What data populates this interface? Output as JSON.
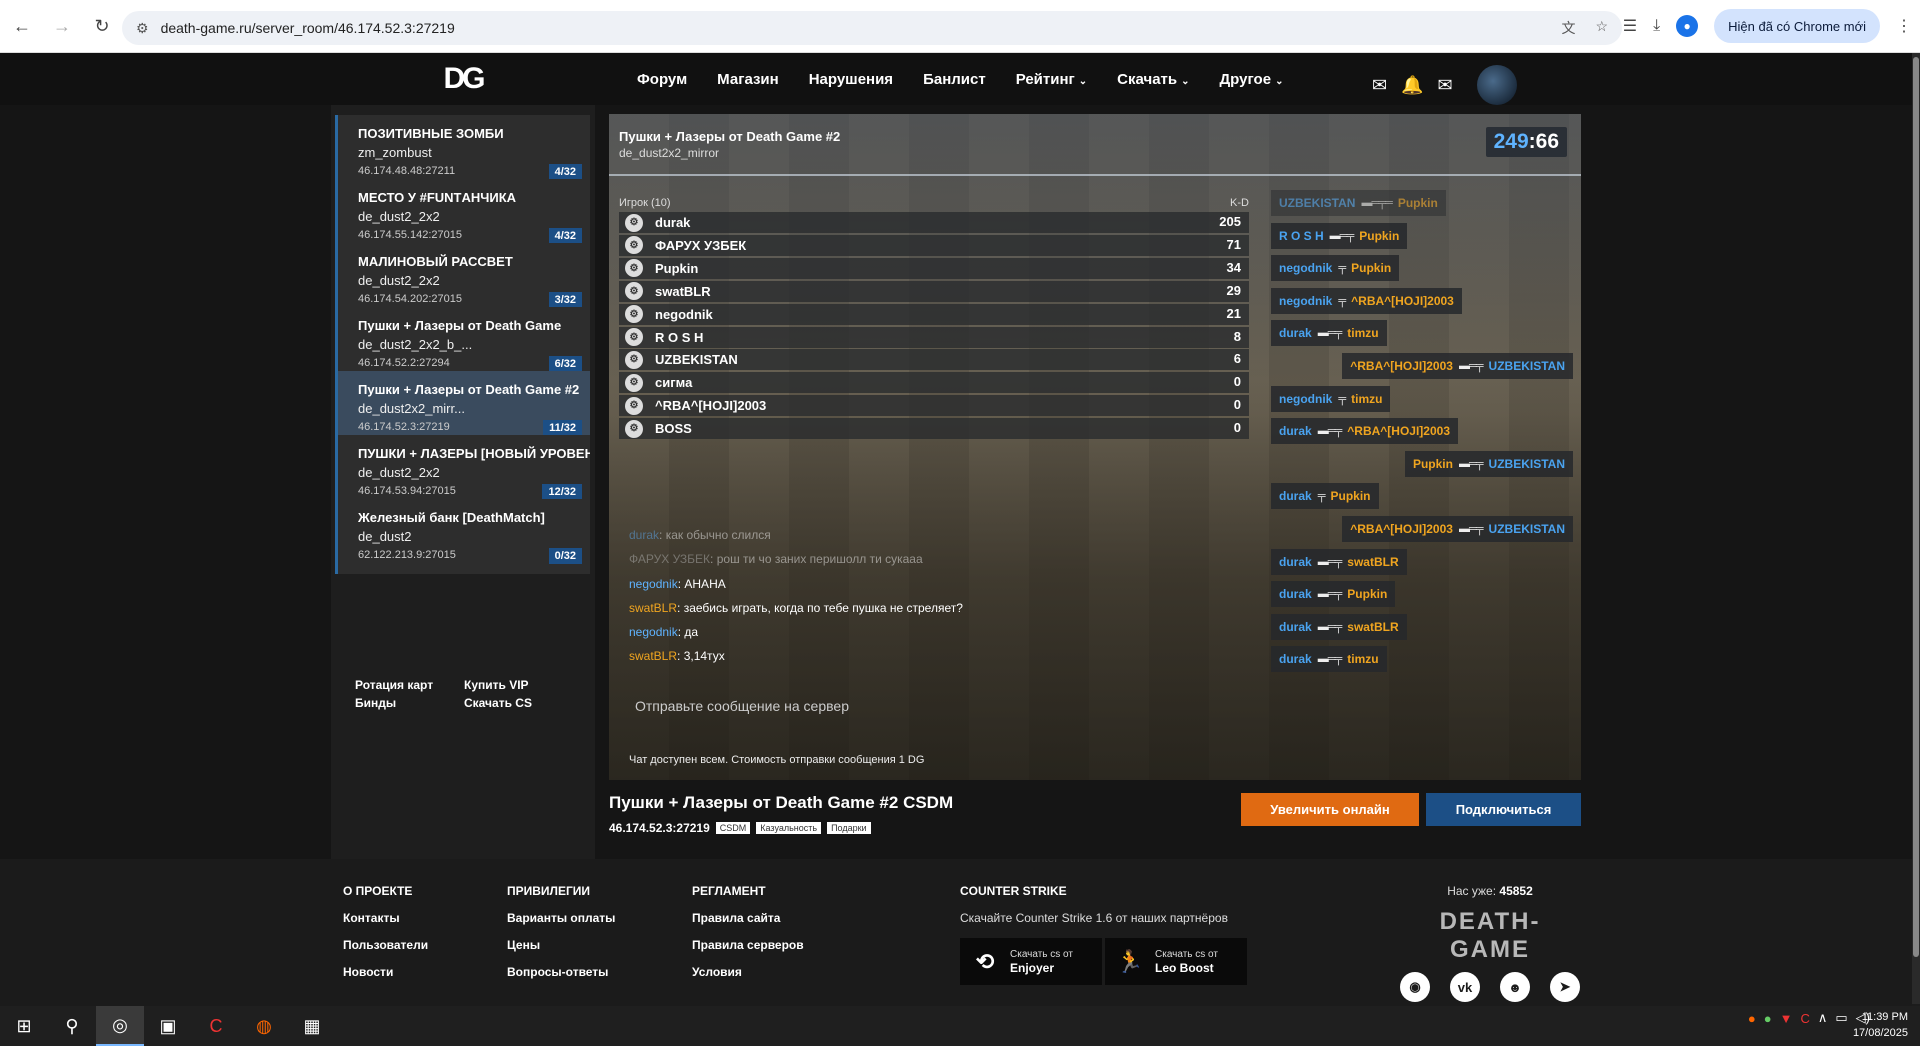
{
  "browser": {
    "url": "death-game.ru/server_room/46.174.52.3:27219",
    "update_label": "Hiện đã có Chrome mới"
  },
  "header": {
    "logo": "DG",
    "menu": [
      {
        "label": "Форум",
        "caret": false
      },
      {
        "label": "Магазин",
        "caret": false
      },
      {
        "label": "Нарушения",
        "caret": false
      },
      {
        "label": "Банлист",
        "caret": false
      },
      {
        "label": "Рейтинг",
        "caret": true
      },
      {
        "label": "Скачать",
        "caret": true
      },
      {
        "label": "Другое",
        "caret": true
      }
    ]
  },
  "sidebar": {
    "servers": [
      {
        "title": "ПОЗИТИВНЫЕ ЗОМБИ",
        "map": "zm_zombust",
        "ip": "46.174.48.48:27211",
        "count": "4/32"
      },
      {
        "title": "МЕСТО У #FUNTАНЧИКА",
        "map": "de_dust2_2x2",
        "ip": "46.174.55.142:27015",
        "count": "4/32"
      },
      {
        "title": "МАЛИНОВЫЙ РАССВЕТ",
        "map": "de_dust2_2x2",
        "ip": "46.174.54.202:27015",
        "count": "3/32"
      },
      {
        "title": "Пушки + Лазеры от Death Game",
        "map": "de_dust2_2x2_b_...",
        "ip": "46.174.52.2:27294",
        "count": "6/32"
      },
      {
        "title": "Пушки + Лазеры от Death Game #2",
        "map": "de_dust2x2_mirr...",
        "ip": "46.174.52.3:27219",
        "count": "11/32"
      },
      {
        "title": "ПУШКИ + ЛАЗЕРЫ [НОВЫЙ УРОВЕНЬ]",
        "map": "de_dust2_2x2",
        "ip": "46.174.53.94:27015",
        "count": "12/32"
      },
      {
        "title": "Железный банк [DeathMatch]",
        "map": "de_dust2",
        "ip": "62.122.213.9:27015",
        "count": "0/32"
      }
    ],
    "links": [
      "Ротация карт",
      "Купить VIP",
      "Бинды",
      "Скачать CS"
    ]
  },
  "game": {
    "title": "Пушки + Лазеры от Death Game #2",
    "map": "de_dust2x2_mirror",
    "timer_a": "249",
    "timer_b": "66",
    "players_header": "Игрок (10)",
    "kd_header": "K-D",
    "players": [
      {
        "name": "durak",
        "score": "205"
      },
      {
        "name": "ФАРУХ УЗБЕК",
        "score": "71"
      },
      {
        "name": "Pupkin",
        "score": "34"
      },
      {
        "name": "swatBLR",
        "score": "29"
      },
      {
        "name": "negodnik",
        "score": "21"
      },
      {
        "name": "R O S H",
        "score": "8"
      },
      {
        "name": "UZBEKISTAN",
        "score": "6"
      },
      {
        "name": "сигма",
        "score": "0"
      },
      {
        "name": "^RBA^[HOJI]2003",
        "score": "0"
      },
      {
        "name": "BOSS",
        "score": "0"
      }
    ],
    "chat": [
      {
        "name": "durak",
        "text": "как обычно слился",
        "color": "b",
        "faded": true
      },
      {
        "name": "ФАРУХ УЗБЕК",
        "text": "рош ти чо заних перишолл ти сукааа",
        "color": "g",
        "faded": true
      },
      {
        "name": "negodnik",
        "text": "АНАНА",
        "color": "b",
        "faded": false
      },
      {
        "name": "swatBLR",
        "text": "заебись играть, когда по тебе пушка не стреляет?",
        "color": "o",
        "faded": false
      },
      {
        "name": "negodnik",
        "text": "да",
        "color": "b",
        "faded": false
      },
      {
        "name": "swatBLR",
        "text": "3,14тух",
        "color": "o",
        "faded": false
      }
    ],
    "chat_placeholder": "Отправьте сообщение на сервер",
    "chat_note": "Чат доступен всем. Стоимость отправки сообщения 1 DG",
    "killfeed": [
      {
        "killer": "UZBEKISTAN",
        "kc": "b",
        "weapon": "▬═╤═",
        "victim": "Pupkin",
        "vc": "o"
      },
      {
        "killer": "R O S H",
        "kc": "b",
        "weapon": "▬═╤",
        "victim": "Pupkin",
        "vc": "o"
      },
      {
        "killer": "negodnik",
        "kc": "b",
        "weapon": "╤",
        "victim": "Pupkin",
        "vc": "o"
      },
      {
        "killer": "negodnik",
        "kc": "b",
        "weapon": "╤",
        "victim": "^RBA^[HOJI]2003",
        "vc": "o"
      },
      {
        "killer": "durak",
        "kc": "b",
        "weapon": "▬═╤",
        "victim": "timzu",
        "vc": "o"
      },
      {
        "killer": "^RBA^[HOJI]2003",
        "kc": "o",
        "weapon": "▬═╤",
        "victim": "UZBEKISTAN",
        "vc": "b"
      },
      {
        "killer": "negodnik",
        "kc": "b",
        "weapon": "╤",
        "victim": "timzu",
        "vc": "o"
      },
      {
        "killer": "durak",
        "kc": "b",
        "weapon": "▬═╤",
        "victim": "^RBA^[HOJI]2003",
        "vc": "o"
      },
      {
        "killer": "Pupkin",
        "kc": "o",
        "weapon": "▬═╤",
        "victim": "UZBEKISTAN",
        "vc": "b"
      },
      {
        "killer": "durak",
        "kc": "b",
        "weapon": "╤",
        "victim": "Pupkin",
        "vc": "o"
      },
      {
        "killer": "^RBA^[HOJI]2003",
        "kc": "o",
        "weapon": "▬═╤",
        "victim": "UZBEKISTAN",
        "vc": "b"
      },
      {
        "killer": "durak",
        "kc": "b",
        "weapon": "▬═╤",
        "victim": "swatBLR",
        "vc": "o"
      },
      {
        "killer": "durak",
        "kc": "b",
        "weapon": "▬═╤",
        "victim": "Pupkin",
        "vc": "o"
      },
      {
        "killer": "durak",
        "kc": "b",
        "weapon": "▬═╤",
        "victim": "swatBLR",
        "vc": "o"
      },
      {
        "killer": "durak",
        "kc": "b",
        "weapon": "▬═╤",
        "victim": "timzu",
        "vc": "o"
      }
    ]
  },
  "server_info": {
    "title": "Пушки + Лазеры от Death Game #2 CSDM",
    "ip": "46.174.52.3:27219",
    "tags": [
      "CSDM",
      "Казуальность",
      "Подарки"
    ],
    "boost_label": "Увеличить онлайн",
    "connect_label": "Подключиться"
  },
  "footer": {
    "about": {
      "title": "О ПРОЕКТЕ",
      "links": [
        "Контакты",
        "Пользователи",
        "Новости"
      ]
    },
    "privileges": {
      "title": "ПРИВИЛЕГИИ",
      "links": [
        "Варианты оплаты",
        "Цены",
        "Вопросы-ответы"
      ]
    },
    "rules": {
      "title": "РЕГЛАМЕНТ",
      "links": [
        "Правила сайта",
        "Правила серверов",
        "Условия"
      ]
    },
    "cs": {
      "title": "COUNTER STRIKE",
      "desc": "Скачайте Counter Strike 1.6 от наших партнёров",
      "partners": [
        {
          "small": "Скачать cs от",
          "name": "Enjoyer"
        },
        {
          "small": "Скачать cs от",
          "name": "Leo Boost"
        }
      ]
    },
    "online_label": "Нас уже:",
    "online_count": "45852",
    "brand": "DEATH-GAME"
  },
  "taskbar": {
    "time": "11:39 PM",
    "date": "17/08/2025"
  }
}
